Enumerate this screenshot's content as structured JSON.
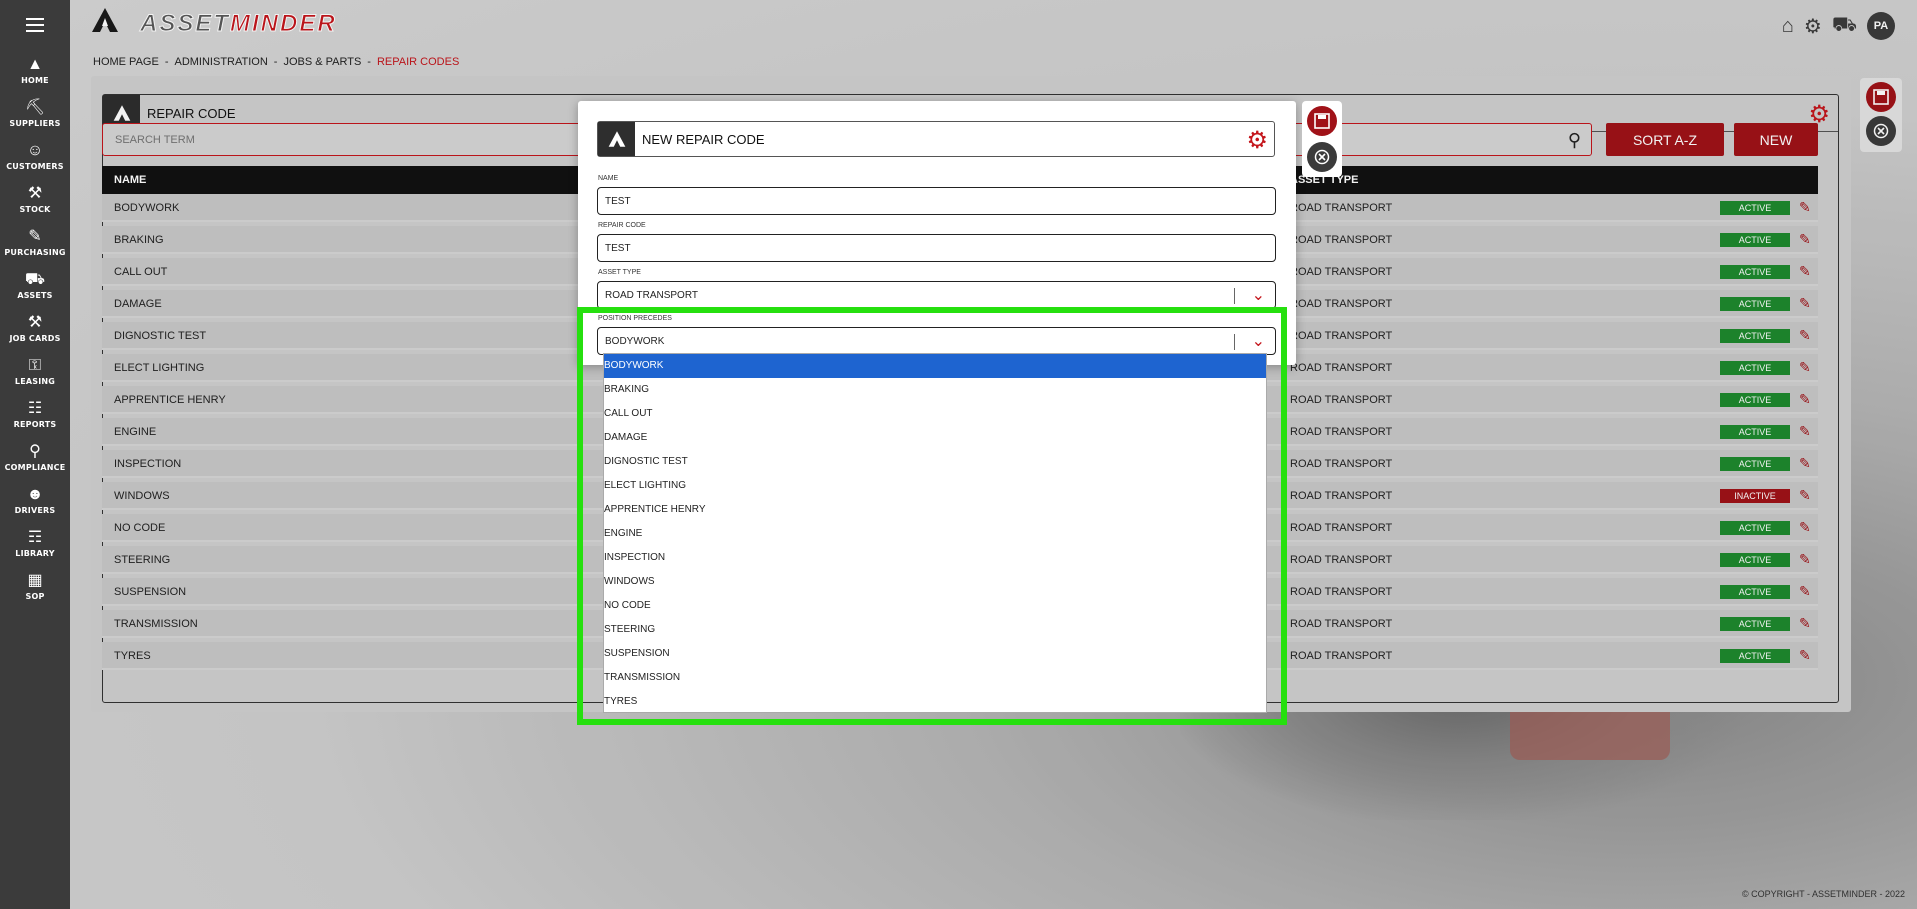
{
  "app": {
    "logo_part1": "ASSET",
    "logo_part2": "MINDER"
  },
  "sidebar": {
    "items": [
      {
        "label": "HOME",
        "icon": "campfire-icon"
      },
      {
        "label": "SUPPLIERS",
        "icon": "supplier-icon"
      },
      {
        "label": "CUSTOMERS",
        "icon": "customers-icon"
      },
      {
        "label": "STOCK",
        "icon": "tools-icon"
      },
      {
        "label": "PURCHASING",
        "icon": "purchasing-icon"
      },
      {
        "label": "ASSETS",
        "icon": "truck-icon"
      },
      {
        "label": "JOB CARDS",
        "icon": "wrench-icon"
      },
      {
        "label": "LEASING",
        "icon": "key-icon"
      },
      {
        "label": "REPORTS",
        "icon": "clipboard-icon"
      },
      {
        "label": "COMPLIANCE",
        "icon": "magnifier-icon"
      },
      {
        "label": "DRIVERS",
        "icon": "driver-icon"
      },
      {
        "label": "LIBRARY",
        "icon": "book-icon"
      },
      {
        "label": "SOP",
        "icon": "sop-icon"
      }
    ]
  },
  "header": {
    "avatar": "PA"
  },
  "breadcrumb": {
    "home": "HOME PAGE",
    "admin": "ADMINISTRATION",
    "jobs": "JOBS & PARTS",
    "current": "REPAIR CODES",
    "sep": "-"
  },
  "panel": {
    "title": "REPAIR CODE",
    "search_placeholder": "SEARCH TERM",
    "sort_label": "SORT A-Z",
    "new_label": "NEW",
    "col_name": "NAME",
    "col_asset_type": "ASSET TYPE"
  },
  "rows": [
    {
      "name": "BODYWORK",
      "type": "ROAD TRANSPORT",
      "status": "ACTIVE"
    },
    {
      "name": "BRAKING",
      "type": "ROAD TRANSPORT",
      "status": "ACTIVE"
    },
    {
      "name": "CALL OUT",
      "type": "ROAD TRANSPORT",
      "status": "ACTIVE"
    },
    {
      "name": "DAMAGE",
      "type": "ROAD TRANSPORT",
      "status": "ACTIVE"
    },
    {
      "name": "DIGNOSTIC TEST",
      "type": "ROAD TRANSPORT",
      "status": "ACTIVE"
    },
    {
      "name": "ELECT LIGHTING",
      "type": "ROAD TRANSPORT",
      "status": "ACTIVE"
    },
    {
      "name": "APPRENTICE HENRY",
      "type": "ROAD TRANSPORT",
      "status": "ACTIVE"
    },
    {
      "name": "ENGINE",
      "type": "ROAD TRANSPORT",
      "status": "ACTIVE"
    },
    {
      "name": "INSPECTION",
      "type": "ROAD TRANSPORT",
      "status": "ACTIVE"
    },
    {
      "name": "WINDOWS",
      "type": "ROAD TRANSPORT",
      "status": "INACTIVE"
    },
    {
      "name": "NO CODE",
      "type": "ROAD TRANSPORT",
      "status": "ACTIVE"
    },
    {
      "name": "STEERING",
      "type": "ROAD TRANSPORT",
      "status": "ACTIVE"
    },
    {
      "name": "SUSPENSION",
      "type": "ROAD TRANSPORT",
      "status": "ACTIVE"
    },
    {
      "name": "TRANSMISSION",
      "type": "ROAD TRANSPORT",
      "status": "ACTIVE"
    },
    {
      "name": "TYRES",
      "type": "ROAD TRANSPORT",
      "status": "ACTIVE"
    }
  ],
  "modal": {
    "title": "NEW REPAIR CODE",
    "name_label": "NAME",
    "name_value": "TEST",
    "code_label": "REPAIR CODE",
    "code_value": "TEST",
    "asset_type_label": "ASSET TYPE",
    "asset_type_value": "ROAD TRANSPORT",
    "position_label": "POSITION PRECEDES",
    "position_value": "BODYWORK"
  },
  "dropdown": {
    "selected": "BODYWORK",
    "options": [
      "BODYWORK",
      "BRAKING",
      "CALL OUT",
      "DAMAGE",
      "DIGNOSTIC TEST",
      "ELECT LIGHTING",
      "APPRENTICE HENRY",
      "ENGINE",
      "INSPECTION",
      "WINDOWS",
      "NO CODE",
      "STEERING",
      "SUSPENSION",
      "TRANSMISSION",
      "TYRES"
    ]
  },
  "footer": {
    "copyright": "© COPYRIGHT - ASSETMINDER - 2022"
  },
  "colors": {
    "brand_red": "#c4161c",
    "active_green": "#1e8a2e",
    "select_blue": "#1e64d0",
    "highlight_green": "#26e00f"
  }
}
